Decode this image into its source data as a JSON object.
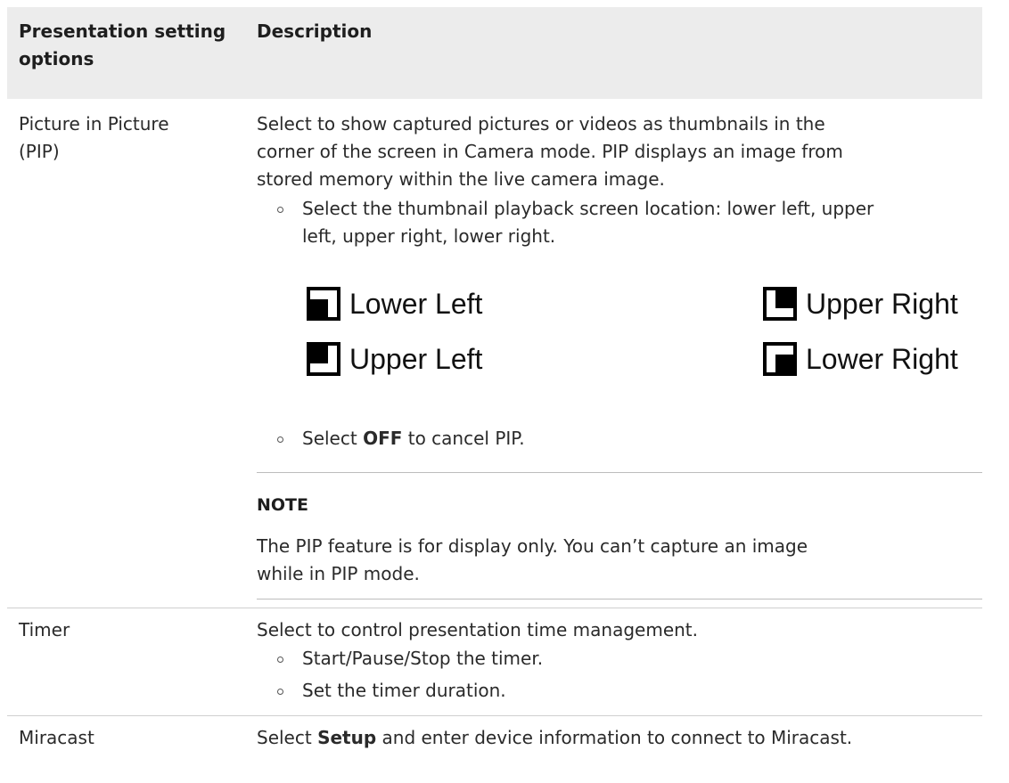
{
  "header": {
    "col1_line1": "Presentation setting",
    "col1_line2": "options",
    "col2": "Description"
  },
  "rows": [
    {
      "name_line1": "Picture in Picture",
      "name_line2": "(PIP)",
      "desc_line1": "Select to show captured pictures or videos as thumbnails in the",
      "desc_line2": "corner of the screen in Camera mode. PIP displays an image from",
      "desc_line3": "stored memory within the live camera image.",
      "bullet1_line1": "Select the thumbnail playback screen location: lower left, upper",
      "bullet1_line2": "left, upper right, lower right.",
      "pip_options": {
        "lower_left": "Lower Left",
        "upper_left": "Upper Left",
        "upper_right": "Upper Right",
        "lower_right": "Lower Right"
      },
      "bullet2_pre": "Select ",
      "bullet2_bold": "OFF",
      "bullet2_post": " to cancel PIP.",
      "note_title": "NOTE",
      "note_line1": "The PIP feature is for display only. You can’t capture an image",
      "note_line2": "while in PIP mode."
    },
    {
      "name": "Timer",
      "desc": "Select to control presentation time management.",
      "bullet1": "Start/Pause/Stop the timer.",
      "bullet2": "Set the timer duration."
    },
    {
      "name": "Miracast",
      "desc_pre": "Select ",
      "desc_bold": "Setup",
      "desc_post": " and enter device information to connect to Miracast."
    }
  ]
}
